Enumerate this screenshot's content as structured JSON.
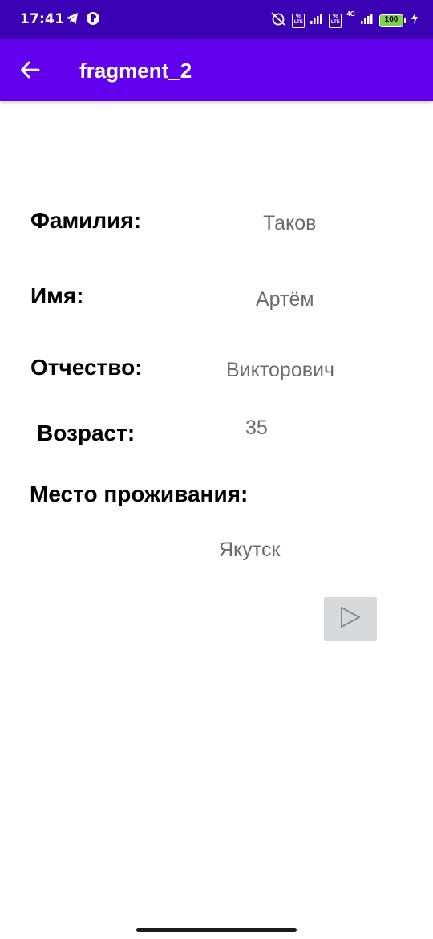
{
  "status_bar": {
    "time": "17:41",
    "network_label": "4G",
    "volte_label_1": "Vo LTE",
    "volte_label_2": "Vo LTE",
    "battery": "100"
  },
  "app_bar": {
    "title": "fragment_2",
    "back_icon": "arrow-back-icon"
  },
  "profile": {
    "surname_label": "Фамилия:",
    "surname_value": "Таков",
    "name_label": "Имя:",
    "name_value": "Артём",
    "patronymic_label": "Отчество:",
    "patronymic_value": "Викторович",
    "age_label": "Возраст:",
    "age_value": "35",
    "residence_label": "Место проживания:",
    "residence_value": "Якутск"
  },
  "actions": {
    "play_icon": "play-icon"
  },
  "colors": {
    "status_bar": "#3a00b3",
    "app_bar": "#6200ee",
    "value_text": "#6b6b6b",
    "play_button_bg": "#d8d9db"
  }
}
